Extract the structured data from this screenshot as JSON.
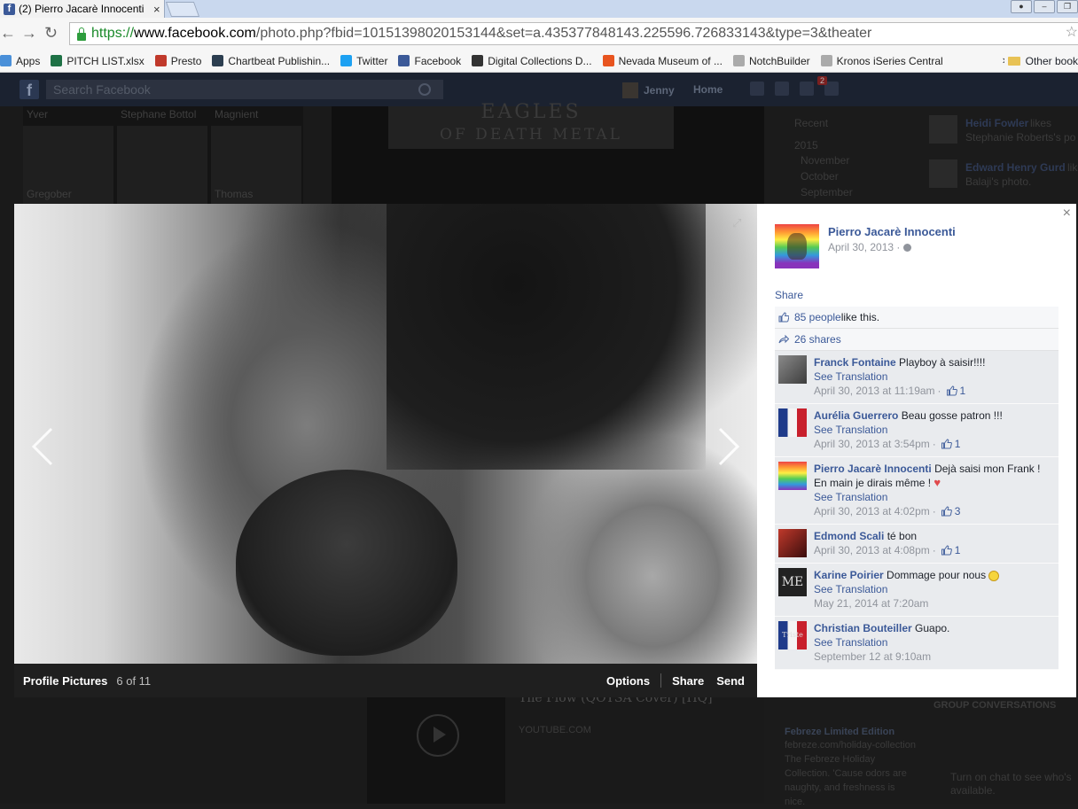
{
  "browser": {
    "tab_title": "(2) Pierro Jacarè Innocenti",
    "url_scheme": "https://",
    "url_host": "www.facebook.com",
    "url_path": "/photo.php?fbid=10151398020153144&set=a.435377848143.225596.726833143&type=3&theater",
    "bookmarks": [
      {
        "label": "Apps",
        "icon": "apps-grid-icon",
        "color": "#4a90d9"
      },
      {
        "label": "PITCH LIST.xlsx",
        "icon": "excel-icon",
        "color": "#1e7145"
      },
      {
        "label": "Presto",
        "icon": "presto-icon",
        "color": "#c0392b"
      },
      {
        "label": "Chartbeat Publishin...",
        "icon": "chartbeat-icon",
        "color": "#2c3e50"
      },
      {
        "label": "Twitter",
        "icon": "twitter-icon",
        "color": "#1da1f2"
      },
      {
        "label": "Facebook",
        "icon": "facebook-icon",
        "color": "#3b5998"
      },
      {
        "label": "Digital Collections D...",
        "icon": "dc-icon",
        "color": "#333333"
      },
      {
        "label": "Nevada Museum of ...",
        "icon": "nevada-museum-icon",
        "color": "#e8541f"
      },
      {
        "label": "NotchBuilder",
        "icon": "page-icon",
        "color": "#aaaaaa"
      },
      {
        "label": "Kronos iSeries Central",
        "icon": "page-icon",
        "color": "#aaaaaa"
      }
    ],
    "bookmarks_more": "»",
    "other_bookmarks": "Other book"
  },
  "fb_header": {
    "logo": "f",
    "search_placeholder": "Search Facebook",
    "user_name": "Jenny",
    "home_label": "Home",
    "notification_count": "2"
  },
  "background": {
    "friends": [
      "Yver",
      "Stephane Bottol",
      "Magnient",
      "Gregober",
      "Thomas"
    ],
    "sign_text": "OF DEATH METAL",
    "sign_top": "EAGLES",
    "timeline": [
      "Recent",
      "2015",
      "November",
      "October",
      "September"
    ],
    "ticker": [
      {
        "name": "Heidi Fowler",
        "text": "likes",
        "sub": "Stephanie Roberts's po"
      },
      {
        "name": "Edward Henry Gurd",
        "text": "lik",
        "sub": "Balaji's photo."
      }
    ],
    "video_title": "The Flow (QOTSA Cover) [HQ]",
    "video_source": "YOUTUBE.COM",
    "ad_title": "Febreze Limited Edition",
    "ad_domain": "febreze.com/holiday-collection",
    "ad_text": "The Febreze Holiday Collection. 'Cause odors are naughty, and freshness is nice.",
    "group_conversations": "GROUP CONVERSATIONS",
    "chat_text": "Turn on chat to see who's available."
  },
  "theater": {
    "album": "Profile Pictures",
    "counter": "6 of 11",
    "options": "Options",
    "share": "Share",
    "send": "Send"
  },
  "panel": {
    "owner_name": "Pierro Jacarè Innocenti",
    "date": "April 30, 2013 ·",
    "share_label": "Share",
    "likes_count": "85 people",
    "likes_suffix": " like this.",
    "shares": "26 shares",
    "comments": [
      {
        "author": "Franck Fontaine",
        "text": "Playboy à saisir!!!!",
        "translate": "See Translation",
        "time": "April 30, 2013 at 11:19am",
        "likes": "1",
        "avatar_color": "#5a5a5a",
        "avatar_style": "gray"
      },
      {
        "author": "Aurélia Guerrero",
        "text": "Beau gosse patron !!!",
        "translate": "See Translation",
        "time": "April 30, 2013 at 3:54pm",
        "likes": "1",
        "avatar_color": "#c0392b",
        "avatar_style": "flag"
      },
      {
        "author": "Pierro Jacarè Innocenti",
        "text": "Dejà saisi mon Frank ! En main je dirais même !",
        "translate": "See Translation",
        "time": "April 30, 2013 at 4:02pm",
        "likes": "3",
        "avatar_color": "#e6a23c",
        "avatar_style": "rainbow",
        "emoji": "heart"
      },
      {
        "author": "Edmond Scali",
        "text": "té bon",
        "translate": "",
        "time": "April 30, 2013 at 4:08pm",
        "likes": "1",
        "avatar_color": "#8b1a1a",
        "avatar_style": "red"
      },
      {
        "author": "Karine Poirier",
        "text": "Dommage pour nous",
        "translate": "See Translation",
        "time": "May 21, 2014 at 7:20am",
        "likes": "",
        "avatar_color": "#222222",
        "avatar_style": "dark",
        "emoji": "smile",
        "avatar_text": "ME"
      },
      {
        "author": "Christian Bouteiller",
        "text": "Guapo.",
        "translate": "See Translation",
        "time": "September 12 at 9:10am",
        "likes": "",
        "avatar_color": "#1f3b8a",
        "avatar_style": "flag",
        "avatar_text": "Triste"
      }
    ]
  }
}
